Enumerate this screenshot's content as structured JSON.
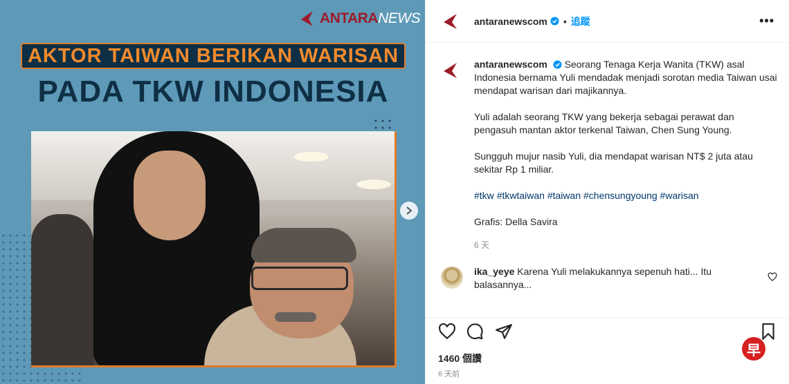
{
  "media": {
    "brand_a": "ANTARA",
    "brand_b": "NEWS",
    "headline_top": "AKTOR TAIWAN BERIKAN WARISAN",
    "headline_bottom": "PADA TKW INDONESIA",
    "next_icon": "chevron-right-icon"
  },
  "header": {
    "username": "antaranewscom",
    "separator": "•",
    "follow_label": "追蹤",
    "more_label": "•••"
  },
  "caption": {
    "username": "antaranewscom",
    "paragraph1": "Seorang Tenaga Kerja Wanita (TKW) asal Indonesia bernama Yuli mendadak menjadi sorotan media Taiwan usai mendapat warisan dari majikannya.",
    "paragraph2": "Yuli adalah seorang TKW yang bekerja sebagai perawat dan pengasuh mantan aktor terkenal Taiwan, Chen Sung Young.",
    "paragraph3": "Sungguh mujur nasib Yuli, dia mendapat warisan NT$ 2 juta atau sekitar Rp 1 miliar.",
    "hashtags": [
      "#tkw",
      "#tkwtaiwan",
      "#taiwan",
      "#chensungyoung",
      "#warisan"
    ],
    "credit": "Grafis: Della Savira",
    "time": "6 天"
  },
  "comment": {
    "username": "ika_yeye",
    "text": "Karena Yuli melakukannya sepenuh hati... Itu balasannya..."
  },
  "actions": {
    "likes": "1460 個讚",
    "posted_ago": "6 天前"
  },
  "watermark": {
    "glyph": "早"
  },
  "colors": {
    "media_bg": "#5e9ab8",
    "headline_orange": "#f08a2c",
    "headline_navy": "#0f2f45",
    "brand_red": "#9b1b28",
    "follow_blue": "#0095f6",
    "hashtag_blue": "#00376b",
    "watermark_red": "#d6201f"
  }
}
